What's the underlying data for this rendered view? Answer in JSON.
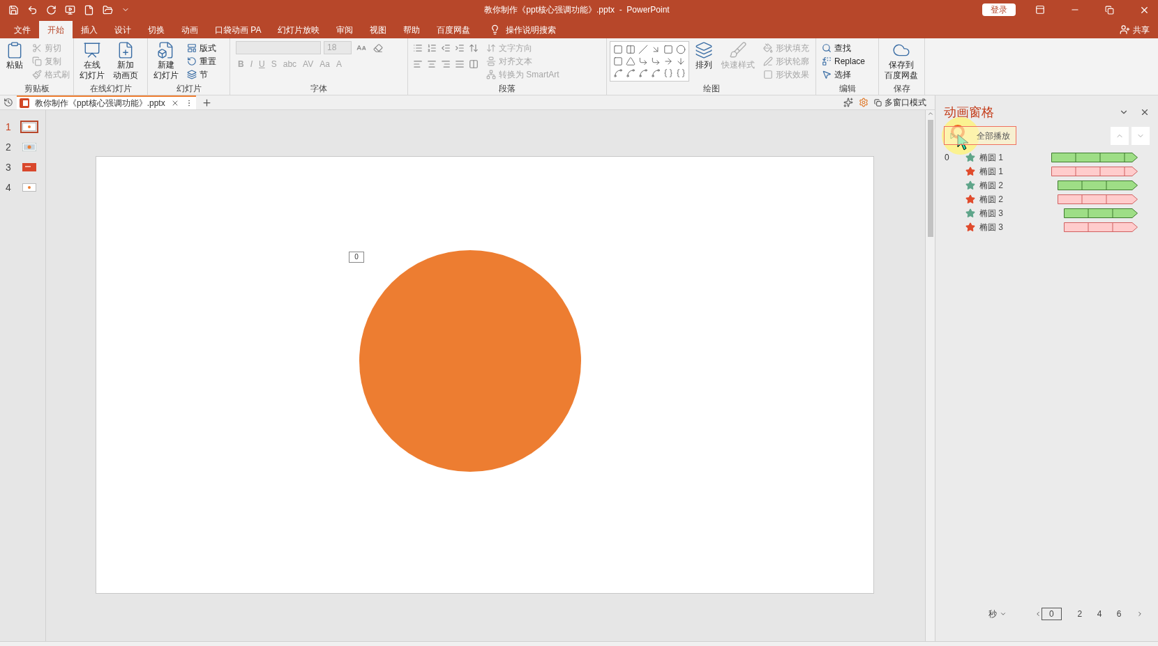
{
  "window": {
    "title": "教你制作《ppt核心强调功能》.pptx  -  PowerPoint",
    "sign_in": "登录"
  },
  "ribbon_tabs": [
    {
      "label": "文件",
      "selected": false
    },
    {
      "label": "开始",
      "selected": true
    },
    {
      "label": "插入",
      "selected": false
    },
    {
      "label": "设计",
      "selected": false
    },
    {
      "label": "切换",
      "selected": false
    },
    {
      "label": "动画",
      "selected": false
    },
    {
      "label": "口袋动画 PA",
      "selected": false
    },
    {
      "label": "幻灯片放映",
      "selected": false
    },
    {
      "label": "审阅",
      "selected": false
    },
    {
      "label": "视图",
      "selected": false
    },
    {
      "label": "帮助",
      "selected": false
    },
    {
      "label": "百度网盘",
      "selected": false
    }
  ],
  "tell_me": "操作说明搜索",
  "share": "共享",
  "ribbon_groups": [
    {
      "title": "剪贴板",
      "controls": [
        {
          "label": "粘贴",
          "disabled": false
        },
        {
          "label": "剪切",
          "disabled": true
        },
        {
          "label": "复制",
          "disabled": true
        },
        {
          "label": "格式刷",
          "disabled": true
        }
      ]
    },
    {
      "title": "在线幻灯片",
      "controls": [
        {
          "lines": [
            "在线",
            "幻灯片"
          ],
          "disabled": false
        },
        {
          "lines": [
            "新加",
            "动画页"
          ],
          "disabled": false
        }
      ]
    },
    {
      "title": "幻灯片",
      "controls": [
        {
          "lines": [
            "新建",
            "幻灯片"
          ],
          "disabled": false
        },
        {
          "label": "版式",
          "disabled": false
        },
        {
          "label": "重置",
          "disabled": false
        },
        {
          "label": "节",
          "disabled": false
        }
      ]
    },
    {
      "title": "字体",
      "font_size": "18",
      "controls": [
        {
          "label": "B",
          "disabled": true
        },
        {
          "label": "I",
          "disabled": true
        },
        {
          "label": "U",
          "disabled": true
        },
        {
          "label": "S",
          "disabled": true
        },
        {
          "label": "abc",
          "disabled": true
        },
        {
          "label": "AV",
          "disabled": true
        },
        {
          "label": "Aa",
          "disabled": true
        },
        {
          "label": "A",
          "disabled": true
        }
      ]
    },
    {
      "title": "段落",
      "controls": [
        {
          "label": "文字方向",
          "disabled": true
        },
        {
          "label": "对齐文本",
          "disabled": true
        },
        {
          "label": "转换为 SmartArt",
          "disabled": true
        }
      ]
    },
    {
      "title": "绘图",
      "controls": [
        {
          "label": "排列",
          "disabled": false
        },
        {
          "label": "快速样式",
          "disabled": true
        },
        {
          "label": "形状填充",
          "disabled": true
        },
        {
          "label": "形状轮廓",
          "disabled": true
        },
        {
          "label": "形状效果",
          "disabled": true
        }
      ]
    },
    {
      "title": "编辑",
      "controls": [
        {
          "label": "查找",
          "disabled": false
        },
        {
          "label": "Replace",
          "disabled": false
        },
        {
          "label": "选择",
          "disabled": false
        }
      ]
    },
    {
      "title": "保存",
      "controls": [
        {
          "lines": [
            "保存到",
            "百度网盘"
          ],
          "disabled": false
        }
      ]
    }
  ],
  "document_tab": {
    "title": "教你制作《ppt核心强调功能》.pptx"
  },
  "multi_window": "多窗口模式",
  "slides": [
    {
      "number": "1",
      "selected": true,
      "kind": "circle"
    },
    {
      "number": "2",
      "selected": false,
      "kind": "photo"
    },
    {
      "number": "3",
      "selected": false,
      "kind": "title"
    },
    {
      "number": "4",
      "selected": false,
      "kind": "circle"
    }
  ],
  "slide": {
    "animation_tag": "0"
  },
  "animation_pane": {
    "title": "动画窗格",
    "play_all": "全部播放",
    "items": [
      {
        "index": "0",
        "kind": "entrance",
        "name": "椭圆 1"
      },
      {
        "kind": "exit",
        "name": "椭圆 1"
      },
      {
        "kind": "entrance",
        "name": "椭圆 2"
      },
      {
        "kind": "exit",
        "name": "椭圆 2"
      },
      {
        "kind": "entrance",
        "name": "椭圆 3"
      },
      {
        "kind": "exit",
        "name": "椭圆 3"
      }
    ],
    "unit": "秒",
    "ticks": [
      "0",
      "2",
      "4",
      "6"
    ]
  }
}
